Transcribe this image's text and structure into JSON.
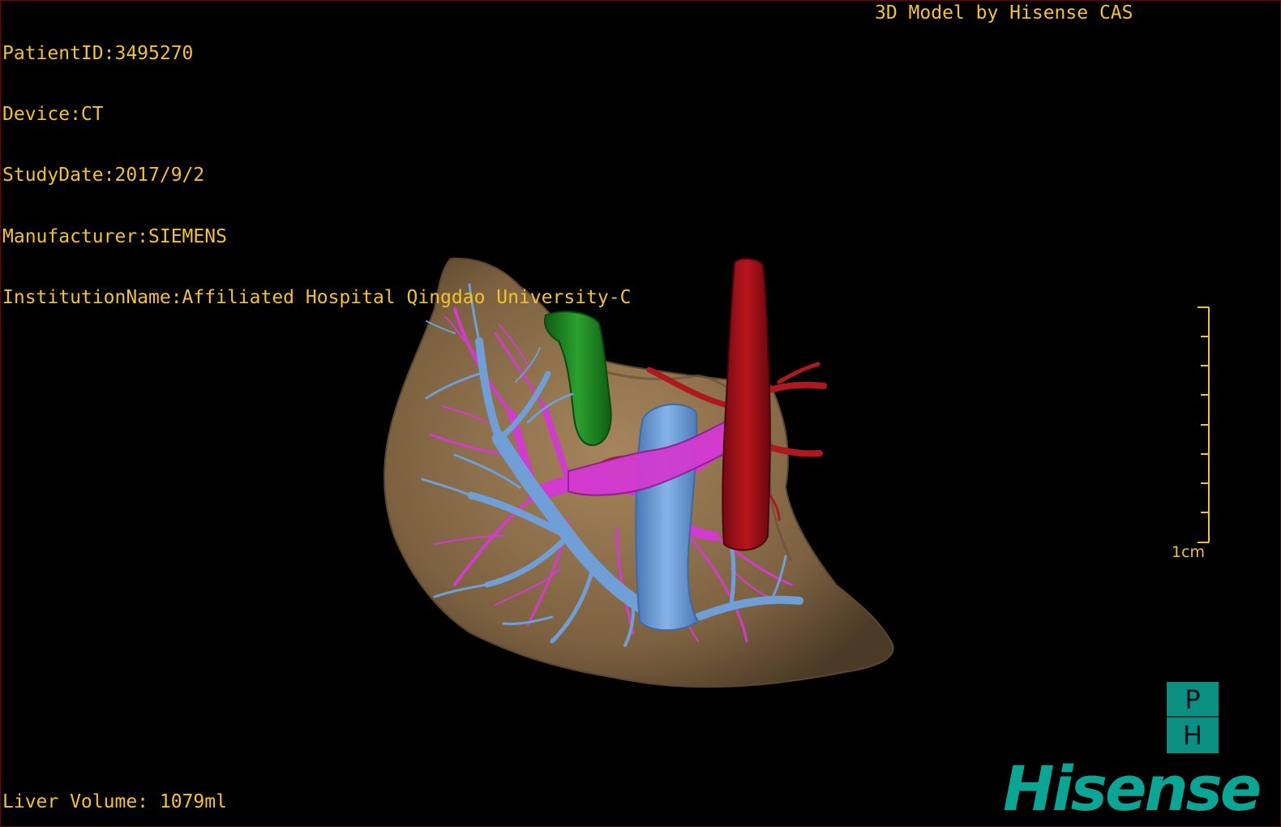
{
  "overlay": {
    "patient_id": "PatientID:3495270",
    "device": "Device:CT",
    "study_date": "StudyDate:2017/9/2",
    "manufacturer": "Manufacturer:SIEMENS",
    "institution": "InstitutionName:Affiliated Hospital Qingdao University-C",
    "credit": "3D Model by Hisense CAS",
    "liver_volume": "Liver Volume: 1079ml"
  },
  "scale": {
    "label": "1cm"
  },
  "orientation": {
    "top": "P",
    "bottom": "H"
  },
  "brand": {
    "name": "Hisense"
  },
  "colors": {
    "overlay_text": "#f2c230",
    "liver": "#8a6d4a",
    "portal_vein": "#6f9fd6",
    "hepatic_vein": "#d23ad0",
    "artery": "#a3121a",
    "gallbladder": "#1e8a22",
    "brand": "#0aa594"
  }
}
